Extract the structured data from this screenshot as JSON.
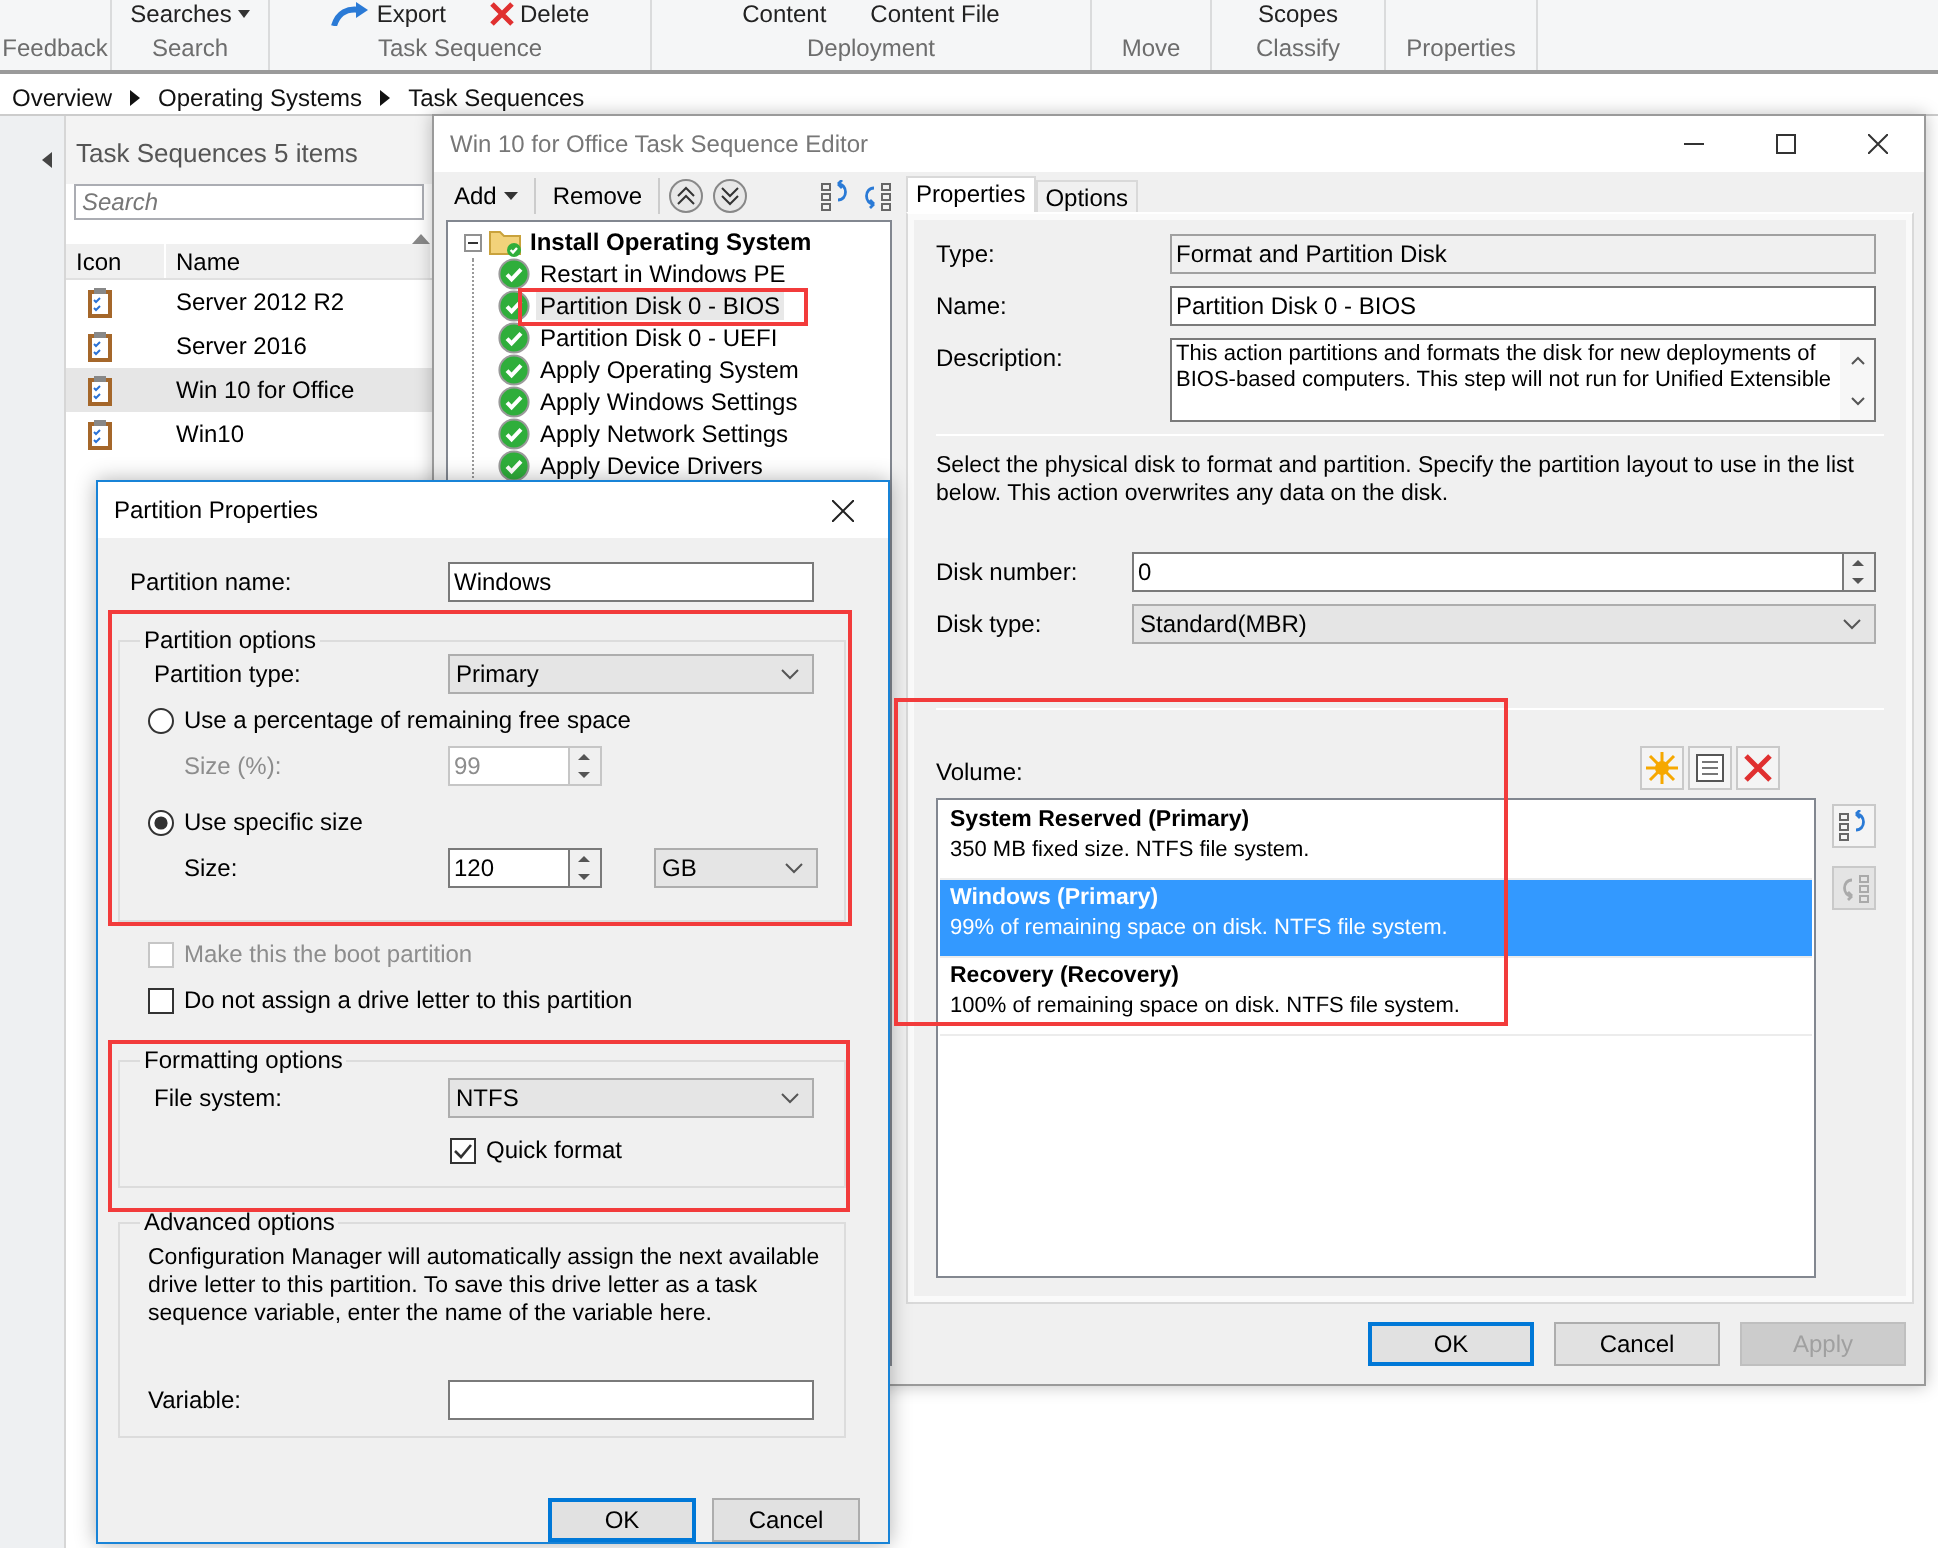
{
  "ribbon": {
    "groups": [
      {
        "label": "Feedback"
      },
      {
        "label": "Search",
        "items": [
          {
            "label": "Searches",
            "kind": "menu"
          }
        ]
      },
      {
        "label": "Task Sequence",
        "items": [
          {
            "label": "Export",
            "kind": "export"
          },
          {
            "label": "Delete",
            "kind": "delete"
          }
        ]
      },
      {
        "label": "Deployment",
        "items": [
          {
            "label": "Content",
            "kind": "plain"
          },
          {
            "label": "Content File",
            "kind": "plain"
          }
        ]
      },
      {
        "label": "Move"
      },
      {
        "label": "Classify",
        "items": [
          {
            "label": "Scopes",
            "kind": "plain"
          }
        ]
      },
      {
        "label": "Properties"
      }
    ]
  },
  "breadcrumb": [
    "Overview",
    "Operating Systems",
    "Task Sequences"
  ],
  "list_pane": {
    "title": "Task Sequences 5 items",
    "search_placeholder": "Search",
    "columns": [
      "Icon",
      "Name"
    ],
    "rows": [
      {
        "name": "Server 2012 R2",
        "selected": false
      },
      {
        "name": "Server 2016",
        "selected": false
      },
      {
        "name": "Win 10 for Office",
        "selected": true
      },
      {
        "name": "Win10",
        "selected": false
      }
    ]
  },
  "editor": {
    "title": "Win 10 for Office Task Sequence Editor",
    "toolbar": [
      {
        "label": "Add",
        "kind": "menu"
      },
      {
        "label": "Remove",
        "kind": "plain"
      }
    ],
    "tree": [
      {
        "label": "Install Operating System",
        "expanded": true,
        "children": [
          {
            "label": "Restart in Windows PE",
            "selected": false
          },
          {
            "label": "Partition Disk 0 - BIOS",
            "selected": true
          },
          {
            "label": "Partition Disk 0 - UEFI",
            "selected": false
          },
          {
            "label": "Apply Operating System",
            "selected": false
          },
          {
            "label": "Apply Windows Settings",
            "selected": false
          },
          {
            "label": "Apply Network Settings",
            "selected": false
          },
          {
            "label": "Apply Device Drivers",
            "selected": false
          }
        ]
      }
    ],
    "tabs": [
      {
        "label": "Properties",
        "selected": true
      },
      {
        "label": "Options",
        "selected": false
      }
    ],
    "type": {
      "label": "Type:",
      "value": "Format and Partition Disk"
    },
    "name": {
      "label": "Name:",
      "value": "Partition Disk 0 - BIOS"
    },
    "description": {
      "label": "Description:",
      "value": "This action partitions and formats the disk for new deployments of BIOS-based computers. This step will not run for Unified Extensible"
    },
    "instructions": "Select the physical disk to format and partition. Specify the partition layout to use in the list below. This action overwrites any data on the disk.",
    "disk_number": {
      "label": "Disk number:",
      "value": "0"
    },
    "disk_type": {
      "label": "Disk type:",
      "value": "Standard(MBR)"
    },
    "volume": {
      "label": "Volume:",
      "items": [
        {
          "title": "System Reserved (Primary)",
          "detail": "350 MB fixed size. NTFS file system.",
          "selected": false
        },
        {
          "title": "Windows (Primary)",
          "detail": "99% of remaining space on disk. NTFS file system.",
          "selected": true
        },
        {
          "title": "Recovery (Recovery)",
          "detail": "100% of remaining space on disk. NTFS file system.",
          "selected": false
        }
      ]
    },
    "buttons": [
      {
        "label": "OK",
        "kind": "default",
        "disabled": false
      },
      {
        "label": "Cancel",
        "kind": "normal",
        "disabled": false
      },
      {
        "label": "Apply",
        "kind": "normal",
        "disabled": true
      }
    ]
  },
  "partition_dialog": {
    "title": "Partition Properties",
    "name_label": "Partition name:",
    "name_value": "Windows",
    "partition_options": {
      "title": "Partition options",
      "type_label": "Partition type:",
      "type_value": "Primary",
      "modes": [
        {
          "label": "Use a percentage of remaining free space",
          "selected": false,
          "size_label": "Size (%):",
          "size_value": "99"
        },
        {
          "label": "Use specific size",
          "selected": true,
          "size_label": "Size:",
          "size_value": "120",
          "unit": "GB"
        }
      ]
    },
    "checks": [
      {
        "label": "Make this the boot partition",
        "checked": false,
        "disabled": true
      },
      {
        "label": "Do not assign a drive letter to this partition",
        "checked": false,
        "disabled": false
      }
    ],
    "formatting": {
      "title": "Formatting options",
      "fs_label": "File system:",
      "fs_value": "NTFS",
      "quick_format": {
        "label": "Quick format",
        "checked": true
      }
    },
    "advanced": {
      "title": "Advanced options",
      "text": "Configuration Manager will automatically assign the next available drive letter to this partition. To save this drive letter as a task sequence variable, enter the name of the variable here.",
      "variable_label": "Variable:"
    },
    "buttons": [
      {
        "label": "OK",
        "kind": "default",
        "disabled": false
      },
      {
        "label": "Cancel",
        "kind": "normal",
        "disabled": false
      }
    ]
  }
}
